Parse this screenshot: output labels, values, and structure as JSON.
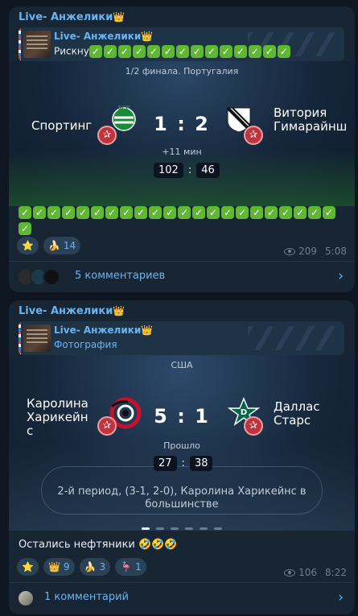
{
  "message1": {
    "author": "Live- Анжелики",
    "author_emoji": "👑",
    "reply": {
      "name": "Live- Анжелики",
      "emoji": "👑",
      "text": "Рискну",
      "check_count": 14
    },
    "card": {
      "league": "1/2 финала. Португалия",
      "home": "Спортинг",
      "away": "Витория Гимарайнш",
      "score": "1 : 2",
      "extra": "+11 мин",
      "timer_left": "102",
      "timer_sep": ":",
      "timer_right": "46"
    },
    "check_count": 23,
    "reactions": [
      {
        "emoji": "⭐",
        "count": ""
      },
      {
        "emoji": "🍌",
        "count": "14"
      }
    ],
    "views": "209",
    "time": "5:08",
    "comments": "5 комментариев"
  },
  "message2": {
    "author": "Live- Анжелики",
    "author_emoji": "👑",
    "reply": {
      "name": "Live- Анжелики",
      "emoji": "👑",
      "text": "Фотография"
    },
    "card": {
      "league": "США",
      "home": "Каролина Харикейн с",
      "away": "Даллас Старс",
      "score": "5 : 1",
      "status": "Прошло",
      "timer_left": "27",
      "timer_sep": ":",
      "timer_right": "38",
      "description": "2-й период, (3-1, 2-0), Каролина Харикейнс в большинстве"
    },
    "caption": "Остались нефтяники",
    "caption_emoji": "🤣🤣🤣",
    "reactions": [
      {
        "emoji": "⭐",
        "count": ""
      },
      {
        "emoji": "👑",
        "count": "9"
      },
      {
        "emoji": "🍌",
        "count": "3"
      },
      {
        "emoji": "🦩",
        "count": "1"
      }
    ],
    "views": "106",
    "time": "8:22",
    "comments": "1 комментарий"
  },
  "icons": {
    "check": "✓",
    "star": "✰",
    "chevron": "›"
  },
  "colors": {
    "background": "#0e1621",
    "bubble": "#182533",
    "accent": "#6ab3f3",
    "check": "#5fb832",
    "badge_red": "#c0343e"
  }
}
